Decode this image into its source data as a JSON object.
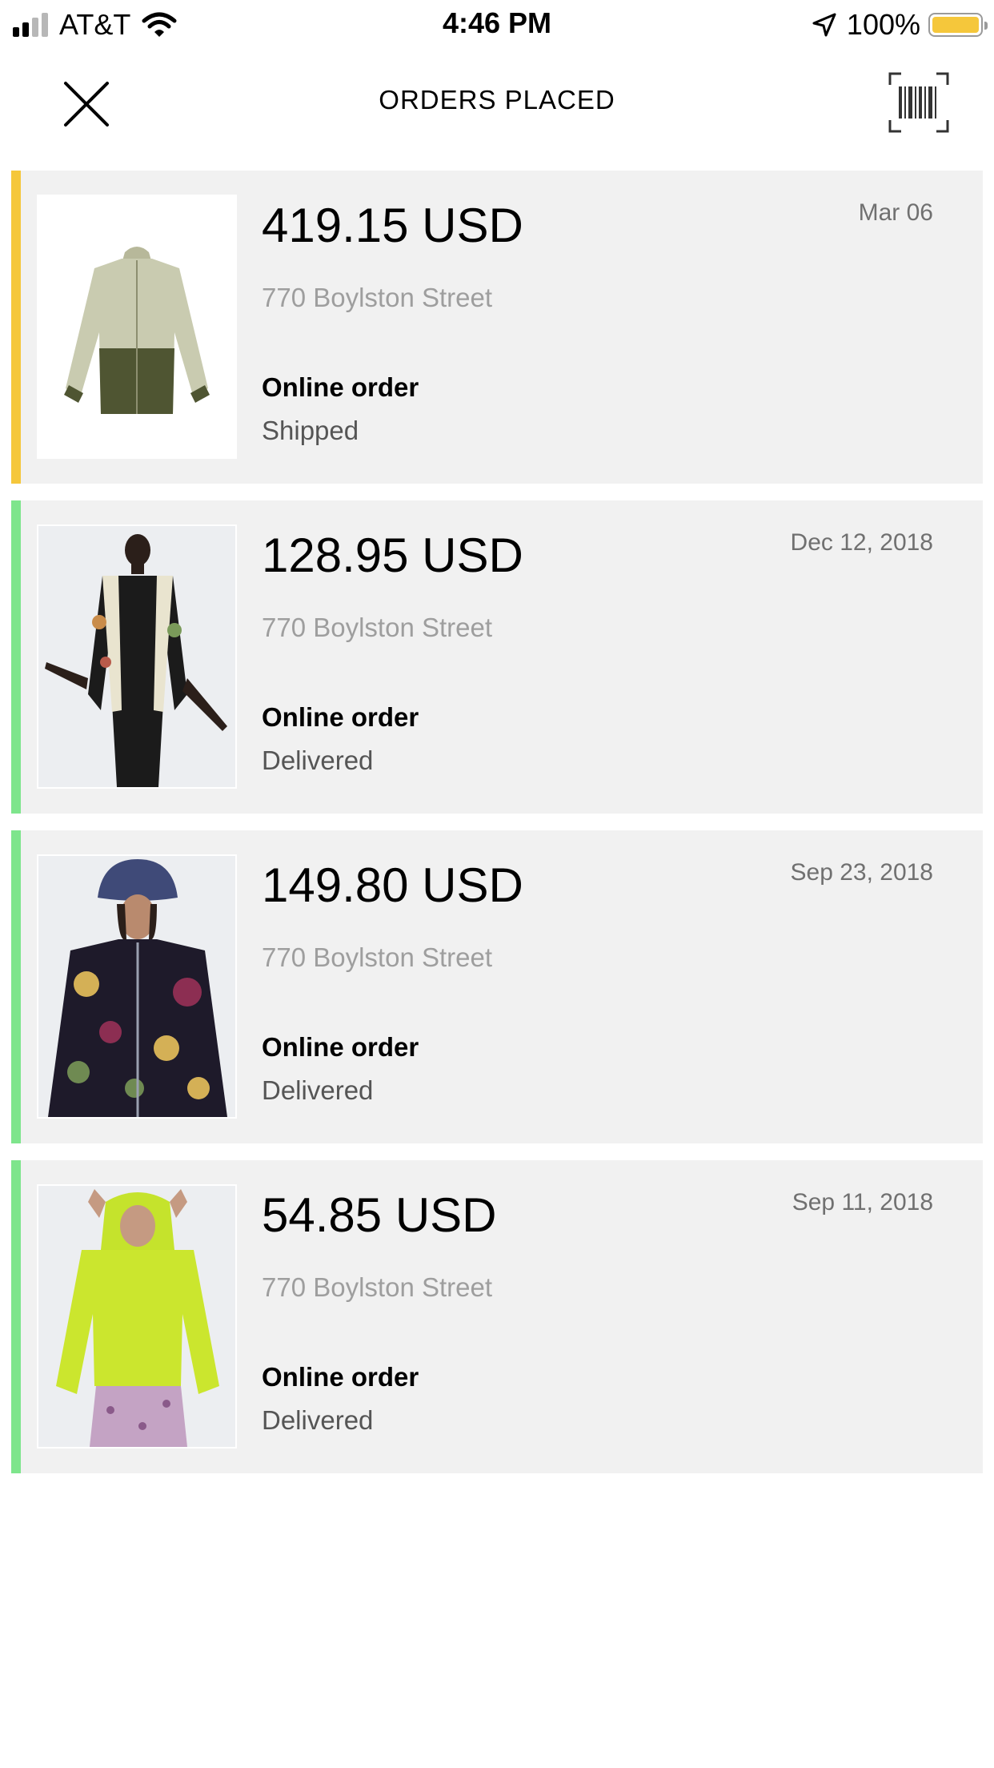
{
  "status_bar": {
    "carrier": "AT&T",
    "time": "4:46 PM",
    "battery": "100%"
  },
  "header": {
    "title": "ORDERS PLACED"
  },
  "colors": {
    "shipped_accent": "#f5c73b",
    "delivered_accent": "#7ee58c",
    "card_bg": "#f1f1f1"
  },
  "orders": [
    {
      "amount": "419.15 USD",
      "address": "770 Boylston Street",
      "channel": "Online order",
      "status": "Shipped",
      "date": "Mar 06",
      "accent": "#f5c73b",
      "image": "olive-sheer-jacket"
    },
    {
      "amount": "128.95 USD",
      "address": "770 Boylston Street",
      "channel": "Online order",
      "status": "Delivered",
      "date": "Dec 12, 2018",
      "accent": "#7ee58c",
      "image": "black-embroidered-jacket-model"
    },
    {
      "amount": "149.80 USD",
      "address": "770 Boylston Street",
      "channel": "Online order",
      "status": "Delivered",
      "date": "Sep 23, 2018",
      "accent": "#7ee58c",
      "image": "floral-bomber-bucket-hat-model"
    },
    {
      "amount": "54.85 USD",
      "address": "770 Boylston Street",
      "channel": "Online order",
      "status": "Delivered",
      "date": "Sep 11, 2018",
      "accent": "#7ee58c",
      "image": "lime-hoodie-model"
    }
  ]
}
